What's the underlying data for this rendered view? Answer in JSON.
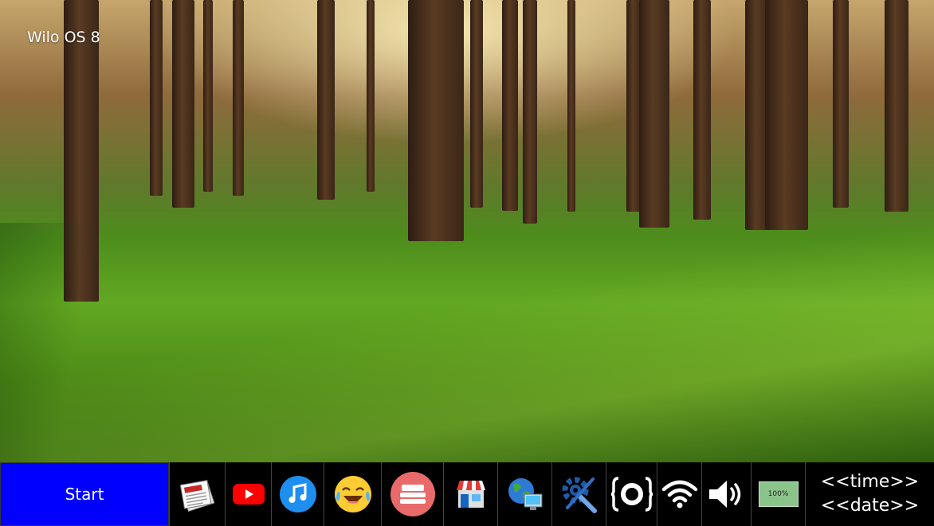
{
  "desktop": {
    "os_name": "Wilo OS 8"
  },
  "taskbar": {
    "start_label": "Start",
    "apps": [
      {
        "name": "news",
        "icon": "newspaper-icon"
      },
      {
        "name": "youtube",
        "icon": "youtube-icon"
      },
      {
        "name": "music",
        "icon": "music-note-icon"
      },
      {
        "name": "emoji",
        "icon": "laughing-crying-emoji-icon"
      },
      {
        "name": "bed",
        "icon": "bed-icon"
      },
      {
        "name": "store",
        "icon": "store-icon"
      },
      {
        "name": "internet",
        "icon": "globe-computer-icon"
      },
      {
        "name": "settings",
        "icon": "wrench-screwdriver-gear-icon"
      },
      {
        "name": "json",
        "icon": "curly-braces-icon"
      }
    ],
    "tray": {
      "wifi_icon": "wifi-icon",
      "volume_icon": "speaker-icon",
      "battery_label": "100%",
      "battery_level": 100
    },
    "time_text": "<<time>>",
    "date_text": "<<date>>"
  },
  "colors": {
    "start_bg": "#0000ff",
    "taskbar_bg": "#000000",
    "youtube_red": "#ff0000",
    "music_blue": "#1e8ff0",
    "bed_red": "#e86a6a",
    "battery_green": "#8bc48b"
  }
}
